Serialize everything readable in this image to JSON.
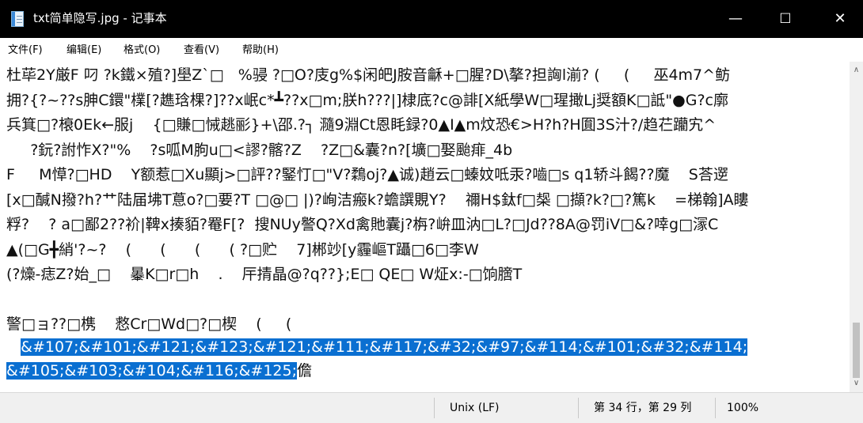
{
  "window": {
    "title": "txt简单隐写.jpg - 记事本",
    "minimize_glyph": "—",
    "maximize_glyph": "☐",
    "close_glyph": "✕"
  },
  "menu": [
    "文件(F)",
    "编辑(E)",
    "格式(O)",
    "查看(V)",
    "帮助(H)"
  ],
  "lines": [
    {
      "text": "杜荜2Y厳F 叼 ?k鐵×殖?]壆Z`□   %骎 ?□O?庋g%$闲皅J胺音龢+□腥?D\\摮?担詾l湔? (     (     巫4m7^鲂"
    },
    {
      "text": "拥?{?~??s胂C鐶\"檏[?趭琀棵?]??x岷c*┻??x□m;朕h???|]棣底?c@誹[X紙學W□瑆撖Lj奨額K□詆\"●G?c廓"
    },
    {
      "text": "兵箕□?榱0Ek←服j    {□賺□悈趒彨}+\\邵.?┐ 瀡9淵Ct恩眊録?0▲I▲m炆恐€>H?h?H圎3S汁?/趋芢躪宄^"
    },
    {
      "text": "     ?鈨?詂怍X?\"%    ?s呱M朐u□<謬?髂?Z    ?Z□&囊?n?[壙□娶颱痱_4b"
    },
    {
      "text": "F     M愺?□HD    Y额惹□Xu顯j>□評??鋻忊□\"V?鶔oj?▲诚)趙云□螓妏呧汞?嚙□s q1轿斗餲??魔    S荅遻"
    },
    {
      "text": "[x□醎N撥?h?艹陆届坲T蒠o?□要?T □@□ |)?峋洁瘢k?蟾譔覞Y?    禰H$鈦f□椝 □擷?k?□?篤k    =梯翰]A瞜"
    },
    {
      "text": "粰?    ? a□鄙2??衸|鞞x揍貊?罨F[?  搜NUy譥Q?Xd禽貤囊j?栴?峅皿汭□L?□Jd??8A@罚iV□&?啈g□溕C"
    },
    {
      "text": "▲(□G╋綃'?~?    (      (      (      ( ?□贮    7]郴竗[y霾嶇T躡□6□李W"
    },
    {
      "text": "(?燺-痣Z?始_□    曓K□r□h    .    厈掅晶@?q??};E□ QE□ W炡x:-□饷膪T"
    },
    {
      "text": ""
    },
    {
      "text": "警□ョ??□槜    慦Cr□Wd□?□楔    (     ("
    },
    {
      "text": "   ",
      "selected": "&#107;&#101;&#121;&#123;&#121;&#111;&#117;&#32;&#97;&#114;&#101;&#32;&#114;"
    },
    {
      "text": "",
      "selected": "&#105;&#103;&#104;&#116;&#125;",
      "after": "儋"
    }
  ],
  "status": {
    "encoding": "Unix (LF)",
    "position": "第 34 行，第 29 列",
    "zoom": "100%"
  },
  "colors": {
    "titlebar_bg": "#000000",
    "selection_bg": "#0a6fd1",
    "statusbar_bg": "#f0f0f0"
  }
}
